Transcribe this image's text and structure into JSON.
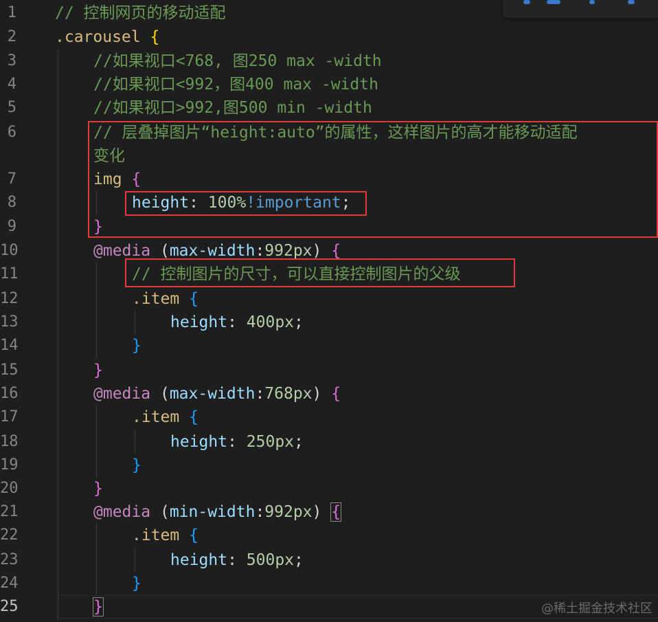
{
  "editor": {
    "lines": [
      {
        "n": "1",
        "parts": [
          {
            "t": "// 控制网页的移动适配",
            "c": "cmt"
          }
        ]
      },
      {
        "n": "2",
        "parts": [
          {
            "t": ".carousel",
            "c": "sel"
          },
          {
            "t": " ",
            "c": "pun"
          },
          {
            "t": "{",
            "c": "b1"
          }
        ]
      },
      {
        "n": "3",
        "parts": [
          {
            "t": "//如果视口<768, 图250 max -width",
            "c": "cmt"
          }
        ]
      },
      {
        "n": "4",
        "parts": [
          {
            "t": "//如果视口<992，图400 max -width",
            "c": "cmt"
          }
        ]
      },
      {
        "n": "5",
        "parts": [
          {
            "t": "//如果视口>992,图500 min -width",
            "c": "cmt"
          }
        ]
      },
      {
        "n": "6",
        "parts": [
          {
            "t": "// 层叠掉图片“height:auto”的属性，这样图片的高才能移动适配",
            "c": "cmt"
          }
        ]
      },
      {
        "n": "",
        "parts": [
          {
            "t": "变化",
            "c": "cmt"
          }
        ]
      },
      {
        "n": "7",
        "parts": [
          {
            "t": "img",
            "c": "tag"
          },
          {
            "t": " ",
            "c": "pun"
          },
          {
            "t": "{",
            "c": "b2"
          }
        ]
      },
      {
        "n": "8",
        "parts": [
          {
            "t": "height",
            "c": "prop"
          },
          {
            "t": ": ",
            "c": "pun"
          },
          {
            "t": "100%",
            "c": "num"
          },
          {
            "t": "!important",
            "c": "imp"
          },
          {
            "t": ";",
            "c": "pun"
          }
        ]
      },
      {
        "n": "9",
        "parts": [
          {
            "t": "}",
            "c": "b2"
          }
        ]
      },
      {
        "n": "10",
        "parts": [
          {
            "t": "@media",
            "c": "kw"
          },
          {
            "t": " ",
            "c": "pun"
          },
          {
            "t": "(",
            "c": "pun"
          },
          {
            "t": "max-width",
            "c": "prop"
          },
          {
            "t": ":",
            "c": "pun"
          },
          {
            "t": "992px",
            "c": "num"
          },
          {
            "t": ")",
            "c": "pun"
          },
          {
            "t": " ",
            "c": "pun"
          },
          {
            "t": "{",
            "c": "b2"
          }
        ]
      },
      {
        "n": "11",
        "parts": [
          {
            "t": "// 控制图片的尺寸，可以直接控制图片的父级",
            "c": "cmt"
          }
        ]
      },
      {
        "n": "12",
        "parts": [
          {
            "t": ".item",
            "c": "sel"
          },
          {
            "t": " ",
            "c": "pun"
          },
          {
            "t": "{",
            "c": "b3"
          }
        ]
      },
      {
        "n": "13",
        "parts": [
          {
            "t": "height",
            "c": "prop"
          },
          {
            "t": ": ",
            "c": "pun"
          },
          {
            "t": "400px",
            "c": "num"
          },
          {
            "t": ";",
            "c": "pun"
          }
        ]
      },
      {
        "n": "14",
        "parts": [
          {
            "t": "}",
            "c": "b3"
          }
        ]
      },
      {
        "n": "15",
        "parts": [
          {
            "t": "}",
            "c": "b2"
          }
        ]
      },
      {
        "n": "16",
        "parts": [
          {
            "t": "@media",
            "c": "kw"
          },
          {
            "t": " ",
            "c": "pun"
          },
          {
            "t": "(",
            "c": "pun"
          },
          {
            "t": "max-width",
            "c": "prop"
          },
          {
            "t": ":",
            "c": "pun"
          },
          {
            "t": "768px",
            "c": "num"
          },
          {
            "t": ")",
            "c": "pun"
          },
          {
            "t": " ",
            "c": "pun"
          },
          {
            "t": "{",
            "c": "b2"
          }
        ]
      },
      {
        "n": "17",
        "parts": [
          {
            "t": ".item",
            "c": "sel"
          },
          {
            "t": " ",
            "c": "pun"
          },
          {
            "t": "{",
            "c": "b3"
          }
        ]
      },
      {
        "n": "18",
        "parts": [
          {
            "t": "height",
            "c": "prop"
          },
          {
            "t": ": ",
            "c": "pun"
          },
          {
            "t": "250px",
            "c": "num"
          },
          {
            "t": ";",
            "c": "pun"
          }
        ]
      },
      {
        "n": "19",
        "parts": [
          {
            "t": "}",
            "c": "b3"
          }
        ]
      },
      {
        "n": "20",
        "parts": [
          {
            "t": "}",
            "c": "b2"
          }
        ]
      },
      {
        "n": "21",
        "parts": [
          {
            "t": "@media",
            "c": "kw"
          },
          {
            "t": " ",
            "c": "pun"
          },
          {
            "t": "(",
            "c": "pun"
          },
          {
            "t": "min-width",
            "c": "prop"
          },
          {
            "t": ":",
            "c": "pun"
          },
          {
            "t": "992px",
            "c": "num"
          },
          {
            "t": ")",
            "c": "pun"
          },
          {
            "t": " ",
            "c": "pun"
          },
          {
            "t": "{",
            "c": "b2",
            "match": true
          }
        ]
      },
      {
        "n": "22",
        "parts": [
          {
            "t": ".item",
            "c": "sel"
          },
          {
            "t": " ",
            "c": "pun"
          },
          {
            "t": "{",
            "c": "b3"
          }
        ]
      },
      {
        "n": "23",
        "parts": [
          {
            "t": "height",
            "c": "prop"
          },
          {
            "t": ": ",
            "c": "pun"
          },
          {
            "t": "500px",
            "c": "num"
          },
          {
            "t": ";",
            "c": "pun"
          }
        ]
      },
      {
        "n": "24",
        "parts": [
          {
            "t": "}",
            "c": "b3"
          }
        ]
      },
      {
        "n": "25",
        "parts": [
          {
            "t": "}",
            "c": "b2",
            "match": true
          }
        ],
        "active": true
      }
    ]
  },
  "watermark": "@稀土掘金技术社区"
}
